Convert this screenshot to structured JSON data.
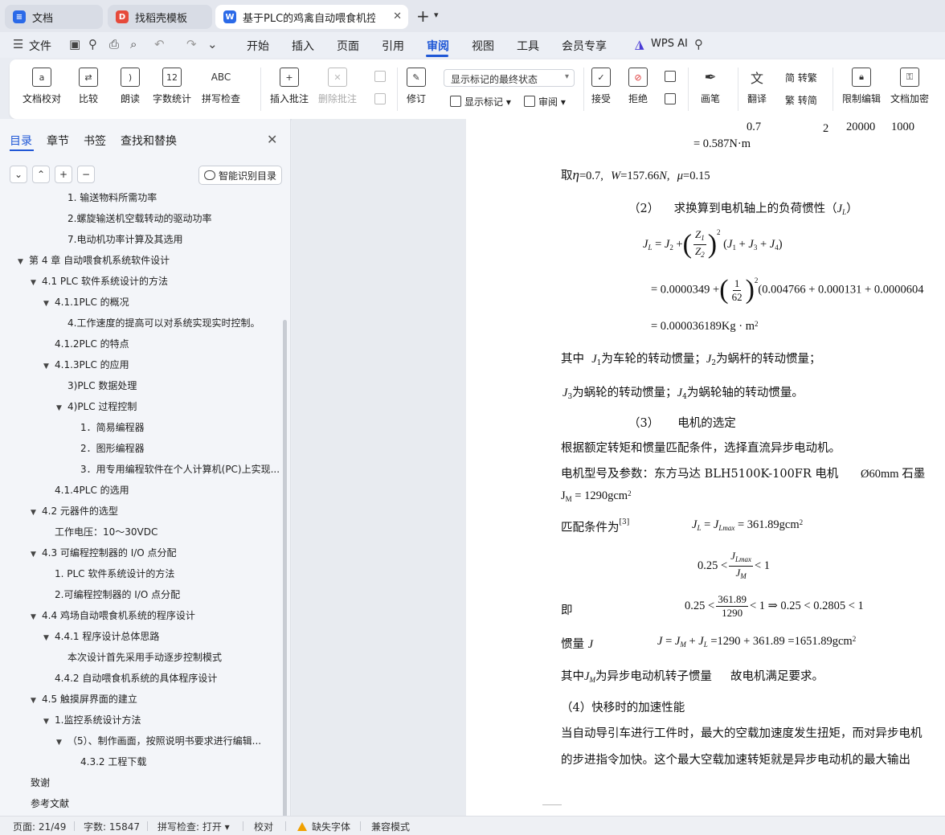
{
  "tabs": {
    "tab1": "文档",
    "tab2": "找稻壳模板",
    "tab3": "基于PLC的鸡禽自动喂食机控制",
    "new_tab": "+",
    "tab_list": "⌄"
  },
  "menu": {
    "file": "文件",
    "items": [
      "开始",
      "插入",
      "页面",
      "引用",
      "审阅",
      "视图",
      "工具",
      "会员专享"
    ],
    "active": "审阅",
    "wps_ai": "WPS AI"
  },
  "ribbon": {
    "proofread": "文档校对",
    "compare": "比较",
    "read_aloud": "朗读",
    "word_count": "字数统计",
    "spell_check": "拼写检查",
    "insert_comment": "插入批注",
    "delete_comment": "删除批注",
    "track": "修订",
    "markup_select": "显示标记的最终状态",
    "show_markup": "显示标记",
    "review": "审阅",
    "accept": "接受",
    "reject": "拒绝",
    "pen": "画笔",
    "translate": "翻译",
    "to_traditional": "简 转繁",
    "to_simplified": "繁 转简",
    "restrict_edit": "限制编辑",
    "encrypt": "文档加密",
    "spell_icon": "ABC",
    "count_icon": "12"
  },
  "nav": {
    "tabs": [
      "目录",
      "章节",
      "书签",
      "查找和替换"
    ],
    "smart_toc": "智能识别目录",
    "toc": [
      {
        "text": "1. 输送物料所需功率",
        "level": 3,
        "tri": ""
      },
      {
        "text": "2.螺旋输送机空载转动的驱动功率",
        "level": 3,
        "tri": ""
      },
      {
        "text": "7.电动机功率计算及其选用",
        "level": 3,
        "tri": ""
      },
      {
        "text": "第 4 章  自动喂食机系统软件设计",
        "level": 0,
        "tri": "▼"
      },
      {
        "text": "4.1 PLC 软件系统设计的方法",
        "level": 1,
        "tri": "▼"
      },
      {
        "text": "4.1.1PLC 的概况",
        "level": 2,
        "tri": "▼"
      },
      {
        "text": "4.工作速度的提高可以对系统实现实时控制。",
        "level": 3,
        "tri": ""
      },
      {
        "text": "4.1.2PLC 的特点",
        "level": 2,
        "tri": ""
      },
      {
        "text": "4.1.3PLC 的应用",
        "level": 2,
        "tri": "▼"
      },
      {
        "text": "3)PLC 数据处理",
        "level": 3,
        "tri": ""
      },
      {
        "text": "4)PLC 过程控制",
        "level": 3,
        "tri": "▼"
      },
      {
        "text": "1．简易编程器",
        "level": 4,
        "tri": ""
      },
      {
        "text": "2．图形编程器",
        "level": 4,
        "tri": ""
      },
      {
        "text": "3．用专用编程软件在个人计算机(PC)上实现...",
        "level": 4,
        "tri": ""
      },
      {
        "text": "4.1.4PLC 的选用",
        "level": 2,
        "tri": ""
      },
      {
        "text": "4.2  元器件的选型",
        "level": 1,
        "tri": "▼"
      },
      {
        "text": "工作电压：10～30VDC",
        "level": 2,
        "tri": ""
      },
      {
        "text": "4.3 可编程控制器的 I/O 点分配",
        "level": 1,
        "tri": "▼"
      },
      {
        "text": "1. PLC 软件系统设计的方法",
        "level": 2,
        "tri": ""
      },
      {
        "text": "2.可编程控制器的 I/O 点分配",
        "level": 2,
        "tri": ""
      },
      {
        "text": "4.4 鸡场自动喂食机系统的程序设计",
        "level": 1,
        "tri": "▼"
      },
      {
        "text": "4.4.1 程序设计总体思路",
        "level": 2,
        "tri": "▼"
      },
      {
        "text": "本次设计首先采用手动逐步控制模式",
        "level": 3,
        "tri": ""
      },
      {
        "text": "4.4.2 自动喂食机系统的具体程序设计",
        "level": 2,
        "tri": ""
      },
      {
        "text": "4.5 触摸屏界面的建立",
        "level": 1,
        "tri": "▼"
      },
      {
        "text": "1.监控系统设计方法",
        "level": 2,
        "tri": "▼"
      },
      {
        "text": "（5）、制作画面，按照说明书要求进行编辑...",
        "level": 3,
        "tri": "▼"
      },
      {
        "text": "4.3.2  工程下载",
        "level": 4,
        "tri": ""
      },
      {
        "text": "致谢",
        "level": -1,
        "tri": ""
      },
      {
        "text": "参考文献",
        "level": -1,
        "tri": ""
      }
    ]
  },
  "doc": {
    "l_top1": "0.7",
    "l_top2": "2",
    "l_top3": "20000",
    "l_top4": "1000",
    "l_torque": "= 0.587N·m",
    "l_eta_a": "取",
    "l_eta_b": "=0.7,",
    "l_eta_c": "=157.66",
    "l_eta_d": ",",
    "l_eta_e": "=0.15",
    "sec2_num": "（2）",
    "sec2_text": "求换算到电机轴上的负荷惯性（",
    "sec2_close": "）",
    "eq1_z1": "Z",
    "eq1_z2": "Z",
    "eq2_a": "= 0.0000349 +",
    "eq2_num": "1",
    "eq2_den": "62",
    "eq2_b": "(0.004766 + 0.000131 + 0.0000604",
    "eq3": "= 0.000036189Kg · m",
    "where1_a": "其中",
    "where1_b": "为车轮的转动惯量；",
    "where1_c": "为蜗杆的转动惯量；",
    "where2_b": "为蜗轮的转动惯量；",
    "where2_c": "为蜗轮轴的转动惯量。",
    "sec3_num": "（3）",
    "sec3_text": "电机的选定",
    "p_choose": "根据额定转矩和惯量匹配条件，选择直流异步电动机。",
    "p_model": "电机型号及参数：东方马达 BLH5100K-100FR 电机",
    "p_model_b": "Ø60mm  石墨",
    "p_jm": "= 1290gcm",
    "p_match": "匹配条件为",
    "p_match_ref": "[3]",
    "p_match_eq": "= 361.89gcm",
    "p_ineq_a": "0.25 <",
    "p_ineq_b": "< 1",
    "p_ji": "即",
    "p_ji_a": "0.25 <",
    "p_ji_num": "361.89",
    "p_ji_den": "1290",
    "p_ji_b": "< 1 ⇒ 0.25 < 0.2805 < 1",
    "p_inertia": "惯量",
    "p_inertia_eq": "=1290 + 361.89 =1651.89gcm",
    "p_where3_a": "其中",
    "p_where3_b": "为异步电动机转子惯量",
    "p_where3_c": "故电机满足要求。",
    "sec4": "（4）快移时的加速性能",
    "p_last1": "当自动导引车进行工件时，最大的空载加速度发生扭矩，而对异步电机",
    "p_last2": "的步进指令加快。这个最大空载加速转矩就是异步电动机的最大输出"
  },
  "status": {
    "page": "页面: 21/49",
    "words": "字数: 15847",
    "spell": "拼写检查: 打开",
    "proof": "校对",
    "missing_font": "缺失字体",
    "compat": "兼容模式"
  },
  "colors": {
    "accent": "#1f57d6",
    "doc_icon": "#2b6ae8",
    "docer_icon": "#e64a3b",
    "wps_icon": "#2b6ae8"
  }
}
